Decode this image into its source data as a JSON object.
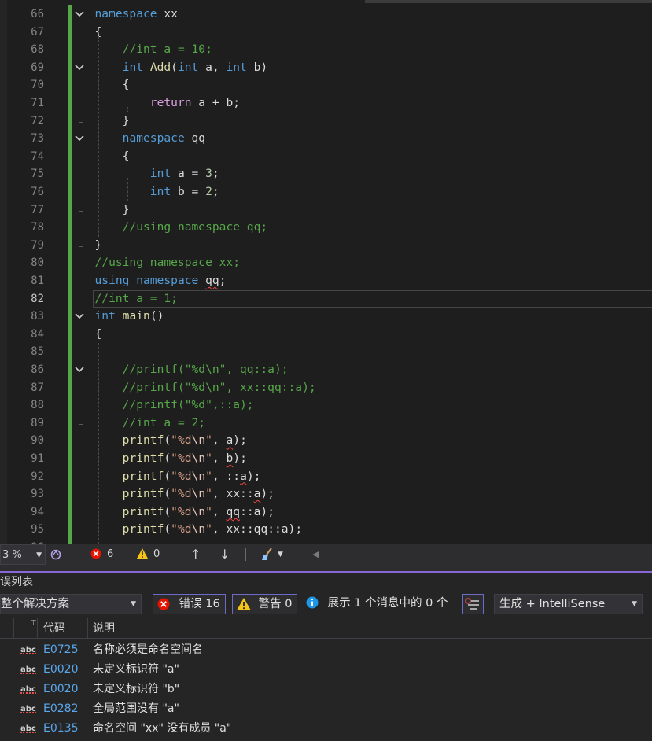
{
  "editor": {
    "lines": [
      {
        "n": "66",
        "code": "<span class=\"kw\">namespace</span> xx"
      },
      {
        "n": "67",
        "code": "{"
      },
      {
        "n": "68",
        "code": "    <span class=\"cm\">//int a = 10;</span>"
      },
      {
        "n": "69",
        "code": "    <span class=\"kw\">int</span> <span class=\"fn\">Add</span>(<span class=\"kw\">int</span> a, <span class=\"kw\">int</span> b)"
      },
      {
        "n": "70",
        "code": "    {"
      },
      {
        "n": "71",
        "code": "        <span class=\"ctrl\">return</span> a + b;"
      },
      {
        "n": "72",
        "code": "    }"
      },
      {
        "n": "73",
        "code": "    <span class=\"kw\">namespace</span> qq"
      },
      {
        "n": "74",
        "code": "    {"
      },
      {
        "n": "75",
        "code": "        <span class=\"kw\">int</span> a = <span class=\"num\">3</span>;"
      },
      {
        "n": "76",
        "code": "        <span class=\"kw\">int</span> b = <span class=\"num\">2</span>;"
      },
      {
        "n": "77",
        "code": "    }"
      },
      {
        "n": "78",
        "code": "    <span class=\"cm\">//using namespace qq;</span>"
      },
      {
        "n": "79",
        "code": "}"
      },
      {
        "n": "80",
        "code": "<span class=\"cm\">//using namespace xx;</span>"
      },
      {
        "n": "81",
        "code": "<span class=\"kw\">using</span> <span class=\"kw\">namespace</span> <span class=\"sq\">qq</span>;"
      },
      {
        "n": "82",
        "code": "<span class=\"cm\">//int a = 1;</span>"
      },
      {
        "n": "83",
        "code": "<span class=\"kw\">int</span> <span class=\"fn\">main</span>()"
      },
      {
        "n": "84",
        "code": "{"
      },
      {
        "n": "85",
        "code": ""
      },
      {
        "n": "86",
        "code": "    <span class=\"cm\">//printf(\"%d\\n\", qq::a);</span>"
      },
      {
        "n": "87",
        "code": "    <span class=\"cm\">//printf(\"%d\\n\", xx::qq::a);</span>"
      },
      {
        "n": "88",
        "code": "    <span class=\"cm\">//printf(\"%d\",::a);</span>"
      },
      {
        "n": "89",
        "code": "    <span class=\"cm\">//int a = 2;</span>"
      },
      {
        "n": "90",
        "code": "    <span class=\"fn\">printf</span>(<span class=\"str\">\"%d<span class=\"esc\">\\n</span>\"</span>, <span class=\"sq\">a</span>);"
      },
      {
        "n": "91",
        "code": "    <span class=\"fn\">printf</span>(<span class=\"str\">\"%d<span class=\"esc\">\\n</span>\"</span>, <span class=\"sq\">b</span>);"
      },
      {
        "n": "92",
        "code": "    <span class=\"fn\">printf</span>(<span class=\"str\">\"%d<span class=\"esc\">\\n</span>\"</span>, ::<span class=\"sq\">a</span>);"
      },
      {
        "n": "93",
        "code": "    <span class=\"fn\">printf</span>(<span class=\"str\">\"%d<span class=\"esc\">\\n</span>\"</span>, xx::<span class=\"sq\">a</span>);"
      },
      {
        "n": "94",
        "code": "    <span class=\"fn\">printf</span>(<span class=\"str\">\"%d<span class=\"esc\">\\n</span>\"</span>, <span class=\"sq\">qq</span>::a);"
      },
      {
        "n": "95",
        "code": "    <span class=\"fn\">printf</span>(<span class=\"str\">\"%d<span class=\"esc\">\\n</span>\"</span>, xx::qq::a);"
      },
      {
        "n": "96",
        "code": ""
      }
    ],
    "current_line": "82",
    "fold_lines": [
      "66",
      "69",
      "73",
      "83",
      "86"
    ]
  },
  "status": {
    "zoom": "3 %",
    "errors": "6",
    "warnings": "0"
  },
  "error_list": {
    "title": "误列表",
    "scope": "整个解决方案",
    "errors_filter": "错误 16",
    "warnings_filter": "警告 0",
    "messages_filter": "展示 1 个消息中的 0 个",
    "build_source": "生成 + IntelliSense",
    "col_code": "代码",
    "col_desc": "说明",
    "icon_label": "abc",
    "rows": [
      {
        "code": "E0725",
        "desc": "名称必须是命名空间名"
      },
      {
        "code": "E0020",
        "desc": "未定义标识符 \"a\""
      },
      {
        "code": "E0020",
        "desc": "未定义标识符 \"b\""
      },
      {
        "code": "E0282",
        "desc": "全局范围没有 \"a\""
      },
      {
        "code": "E0135",
        "desc": "命名空间 \"xx\" 没有成员 \"a\""
      }
    ]
  },
  "colors": {
    "editor_bg": "#1e1e1e",
    "keyword": "#569cd6",
    "comment": "#57a64a",
    "function": "#dcdcaa",
    "string": "#d69d85",
    "error_red": "#e05252",
    "accent_purple": "#8a67d6"
  }
}
